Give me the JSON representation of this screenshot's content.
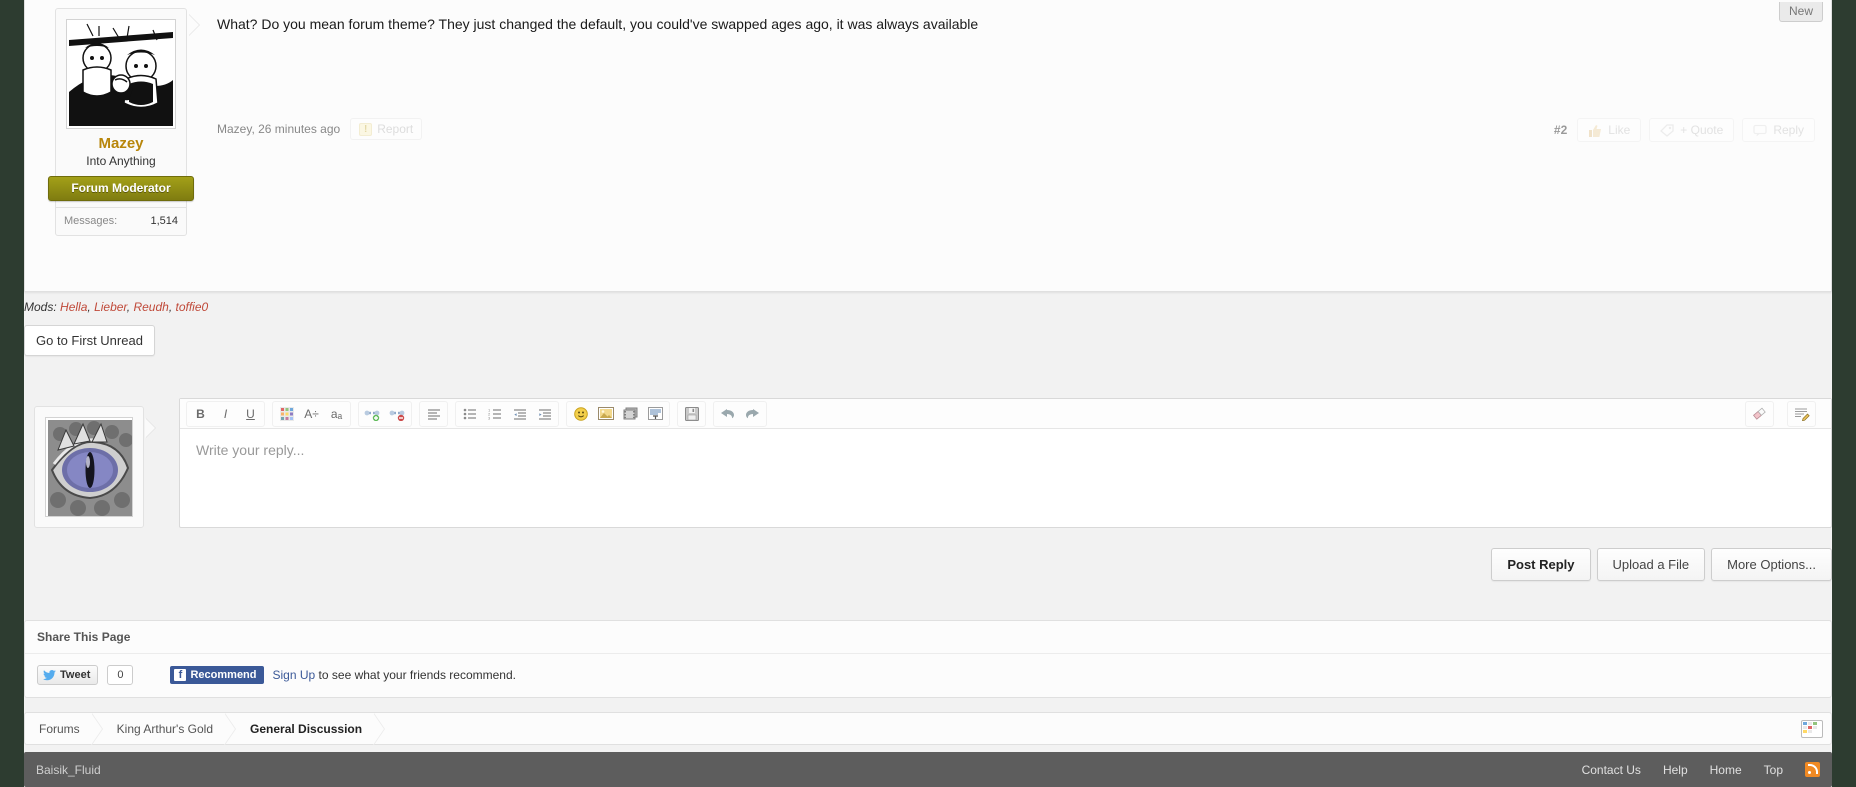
{
  "post": {
    "new_badge": "New",
    "author": "Mazey",
    "user_title": "Into Anything",
    "banner": "Forum Moderator",
    "messages_label": "Messages:",
    "messages_count": "1,514",
    "body": "What? Do you mean forum theme? They just changed the default, you could've swapped ages ago, it was always available",
    "meta": "Mazey, 26 minutes ago",
    "report_label": "Report",
    "post_number": "#2",
    "like_label": "Like",
    "quote_label": "+ Quote",
    "reply_label": "Reply"
  },
  "mods": {
    "label": "Mods:",
    "names": [
      "Hella",
      "Lieber",
      "Reudh",
      "toffie0"
    ]
  },
  "unread_button": "Go to First Unread",
  "editor": {
    "placeholder": "Write your reply...",
    "toolbar": [
      {
        "name": "bold-icon",
        "glyph": "B",
        "style": "bold"
      },
      {
        "name": "italic-icon",
        "glyph": "I",
        "style": "italic"
      },
      {
        "name": "underline-icon",
        "glyph": "U",
        "style": "underline"
      },
      {
        "name": "text-color-icon",
        "glyph": "palette"
      },
      {
        "name": "font-size-icon",
        "glyph": "A÷"
      },
      {
        "name": "font-family-icon",
        "glyph": "aₐ"
      },
      {
        "name": "insert-link-icon",
        "glyph": "link-add"
      },
      {
        "name": "remove-link-icon",
        "glyph": "link-remove"
      },
      {
        "name": "align-icon",
        "glyph": "align"
      },
      {
        "name": "bullet-list-icon",
        "glyph": "ul"
      },
      {
        "name": "numbered-list-icon",
        "glyph": "ol"
      },
      {
        "name": "outdent-icon",
        "glyph": "outdent"
      },
      {
        "name": "indent-icon",
        "glyph": "indent"
      },
      {
        "name": "smilies-icon",
        "glyph": "smiley"
      },
      {
        "name": "insert-image-icon",
        "glyph": "image"
      },
      {
        "name": "insert-media-icon",
        "glyph": "media"
      },
      {
        "name": "insert-quote-icon",
        "glyph": "quote"
      },
      {
        "name": "save-draft-icon",
        "glyph": "floppy"
      },
      {
        "name": "undo-icon",
        "glyph": "undo"
      },
      {
        "name": "redo-icon",
        "glyph": "redo"
      },
      {
        "name": "eraser-icon",
        "glyph": "eraser"
      },
      {
        "name": "source-mode-icon",
        "glyph": "pencil"
      }
    ]
  },
  "buttons": {
    "post_reply": "Post Reply",
    "upload_file": "Upload a File",
    "more_options": "More Options..."
  },
  "share": {
    "title": "Share This Page",
    "tweet_label": "Tweet",
    "tweet_count": "0",
    "recommend_label": "Recommend",
    "signup_label": "Sign Up",
    "signup_rest": " to see what your friends recommend."
  },
  "breadcrumb": [
    "Forums",
    "King Arthur's Gold",
    "General Discussion"
  ],
  "footer": {
    "style_name": "Baisik_Fluid",
    "links": [
      "Contact Us",
      "Help",
      "Home",
      "Top"
    ],
    "rss": "rss-icon"
  },
  "colors": {
    "page_bg": "#2d3c30",
    "banner": "#8f8c14",
    "username": "#b8860b",
    "mod_link": "#c04a3a",
    "facebook": "#3b5998",
    "rss": "#f08a24"
  }
}
